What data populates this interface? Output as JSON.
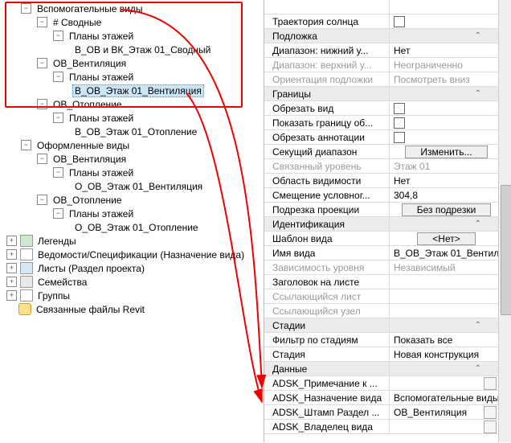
{
  "tree": {
    "aux_views": "Вспомогательные виды",
    "svodnye": "# Сводные",
    "plans": "Планы этажей",
    "v_ov_vk_svod": "В_ОВ и ВК_Этаж 01_Сводный",
    "ov_vent": "ОВ_Вентиляция",
    "v_ov_vent": "В_ОВ_Этаж 01_Вентиляция",
    "ov_otop": "ОВ_Отопление",
    "v_ov_otop": "В_ОВ_Этаж 01_Отопление",
    "oformlennye": "Оформленные виды",
    "o_ov_vent": "О_ОВ_Этаж 01_Вентиляция",
    "o_ov_otop": "О_ОВ_Этаж 01_Отопление",
    "legends": "Легенды",
    "schedules": "Ведомости/Спецификации (Назначение вида)",
    "sheets": "Листы (Раздел проекта)",
    "families": "Семейства",
    "groups": "Группы",
    "links": "Связанные файлы Revit"
  },
  "props": {
    "sun_traj_k": "Траектория солнца",
    "h_underlay": "Подложка",
    "range_bottom_k": "Диапазон: нижний у...",
    "range_bottom_v": "Нет",
    "range_top_k": "Диапазон: верхний у...",
    "range_top_v": "Неограниченно",
    "orient_underlay_k": "Ориентация подложки",
    "orient_underlay_v": "Посмотреть вниз",
    "h_bounds": "Границы",
    "crop_view_k": "Обрезать вид",
    "show_crop_k": "Показать границу об...",
    "anno_crop_k": "Обрезать аннотации",
    "sec_range_k": "Секущий диапазон",
    "sec_range_v": "Изменить...",
    "assoc_level_k": "Связанный уровень",
    "assoc_level_v": "Этаж 01",
    "scope_k": "Область видимости",
    "scope_v": "Нет",
    "offset_k": "Смещение условног...",
    "offset_v": "304,8",
    "proj_crop_k": "Подрезка проекции",
    "proj_crop_v": "Без подрезки",
    "h_ident": "Идентификация",
    "view_tmpl_k": "Шаблон вида",
    "view_tmpl_v": "<Нет>",
    "view_name_k": "Имя вида",
    "view_name_v": "В_ОВ_Этаж 01_Вентил...",
    "dep_level_k": "Зависимость уровня",
    "dep_level_v": "Независимый",
    "title_sheet_k": "Заголовок на листе",
    "ref_sheet_k": "Ссылающийся лист",
    "ref_node_k": "Ссылающийся узел",
    "h_phases": "Стадии",
    "ph_filter_k": "Фильтр по стадиям",
    "ph_filter_v": "Показать все",
    "phase_k": "Стадия",
    "phase_v": "Новая конструкция",
    "h_data": "Данные",
    "note_k": "ADSK_Примечание к ...",
    "naznach_k": "ADSK_Назначение вида",
    "naznach_v": "Вспомогательные виды",
    "stamp_k": "ADSK_Штамп Раздел ...",
    "stamp_v": "ОВ_Вентиляция",
    "owner_k": "ADSK_Владелец вида"
  }
}
